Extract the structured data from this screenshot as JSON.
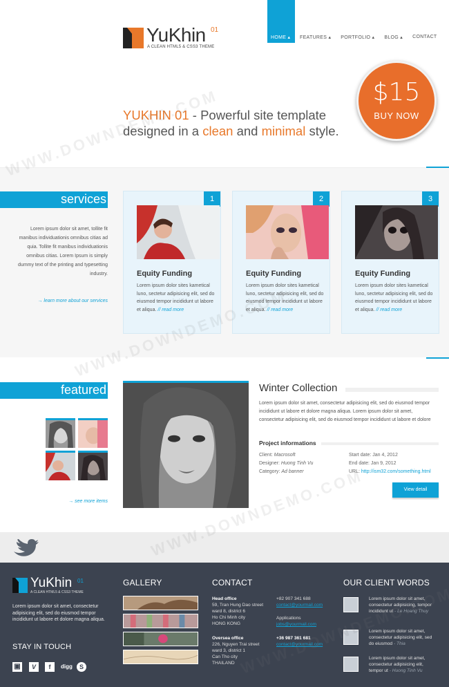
{
  "header": {
    "logo_name": "YuKhin",
    "logo_sup": "01",
    "logo_tagline": "A CLEAN HTML5 & CSS3 THEME",
    "nav": [
      {
        "label": "HOME ▴",
        "active": true
      },
      {
        "label": "FEATURES ▴"
      },
      {
        "label": "PORTFOLIO ▴"
      },
      {
        "label": "BLOG ▴"
      },
      {
        "label": "CONTACT"
      }
    ]
  },
  "hero": {
    "brand": "YUKHIN 01",
    "line1_rest": " - Powerful site template",
    "line2_a": "designed in a ",
    "word_clean": "clean",
    "line2_b": " and ",
    "word_minimal": "minimal",
    "line2_c": " style."
  },
  "price": {
    "amount": "$15",
    "cta": "BUY NOW"
  },
  "services": {
    "label": "services",
    "text": "Lorem ipsum dolor sit amet, tollite fit manibus individuationis omnibus citias ad quia. Tollite fit manibus individuationis omnibus citias. Lorem Ipsum is simply dummy text of the printing and typesetting industry.",
    "more": "→ learn more about our services",
    "cards": [
      {
        "num": "1",
        "title": "Equity Funding",
        "text": "Lorem ipsum dolor sites kametical luno, sectetur adipisicing elit, sed do eiusmod tempor incididunt ut labore et aliqua.",
        "read_more": "// read more"
      },
      {
        "num": "2",
        "title": "Equity Funding",
        "text": "Lorem ipsum dolor sites kametical luno, sectetur adipisicing elit, sed do eiusmod tempor incididunt ut labore et aliqua.",
        "read_more": "// read more"
      },
      {
        "num": "3",
        "title": "Equity Funding",
        "text": "Lorem ipsum dolor sites kametical luno, sectetur adipisicing elit, sed do eiusmod tempor incididunt ut labore et aliqua.",
        "read_more": "// read more"
      }
    ]
  },
  "featured": {
    "label": "featured",
    "more": "→ see more items",
    "title": "Winter Collection",
    "text": "Lorem ipsum dolor sit amet, consectetur adipisicing elit, sed do eiusmod tempor incididunt ut labore et dolore magna aliqua. Lorem ipsum dolor sit amet, consectetur adipisicing elit, sed do eiusmod tempor incididunt ut labore et dolore",
    "project_title": "Project informations",
    "client_label": "Client:",
    "client": "Macrosoft",
    "designer_label": "Designer:",
    "designer": "Huong Tinh Vu",
    "category_label": "Category:",
    "category": "Ad banner",
    "start_label": "Start date:",
    "start": "Jan 4, 2012",
    "end_label": "End date:",
    "end": "Jan 9, 2012",
    "url_label": "URL:",
    "url": "http://ism32.com/something.html",
    "button": "View detail"
  },
  "footer": {
    "logo_name": "YuKhin",
    "logo_sup": "01",
    "logo_tagline": "A CLEAN HTML5 & CSS3 THEME",
    "about": "Lorem ipsum dolor sit amet, consectetur adipisicing elit, sed do eiusmod tempor incididunt ut labore et dolore magna aliqua.",
    "stay_in_touch": "STAY IN TOUCH",
    "social": [
      "delicious",
      "vimeo",
      "facebook",
      "digg",
      "skype"
    ],
    "social_glyph": {
      "delicious": "▣",
      "vimeo": "V",
      "facebook": "f",
      "digg": "digg",
      "skype": "S"
    },
    "gallery_title": "GALLERY",
    "contact_title": "CONTACT",
    "head_office_label": "Head office",
    "head_office": [
      "59, Tran Hung Dao street",
      "ward 8, district 6",
      "Ho Chi Minh city",
      "HONG KONG"
    ],
    "head_phone": "+82 907 341 688",
    "head_email": "contact@yourmail.com",
    "applications_label": "Applications",
    "applications_email": "jobs@yourmail.com",
    "oversea_label": "Oversea office",
    "oversea": [
      "226, Nguyen Trai street",
      "ward 3, district 1",
      "Can Tho city",
      "THAILAND"
    ],
    "oversea_phone": "+36 987 361 681",
    "oversea_email": "contact@yourmail.com",
    "clients_title": "OUR CLIENT WORDS",
    "quotes": [
      {
        "text": "Lorem ipsum dolor sit amet, consectetur adipisicing, tempor incididunt ut",
        "author": "- Le Hoang Thuy"
      },
      {
        "text": "Lorem ipsum dolor sit amet, consectetur adipisicing elit, sed do eiusmod",
        "author": "- Thia"
      },
      {
        "text": "Lorem ipsum dolor sit amet, consectetur adipisicing elit, tempor ut",
        "author": "- Huong Tinh Vu"
      }
    ]
  },
  "watermark": "WWW.DOWNDEMO.COM",
  "colors": {
    "accent": "#0fa2d6",
    "orange": "#e8782a",
    "footer": "#3c4350"
  }
}
